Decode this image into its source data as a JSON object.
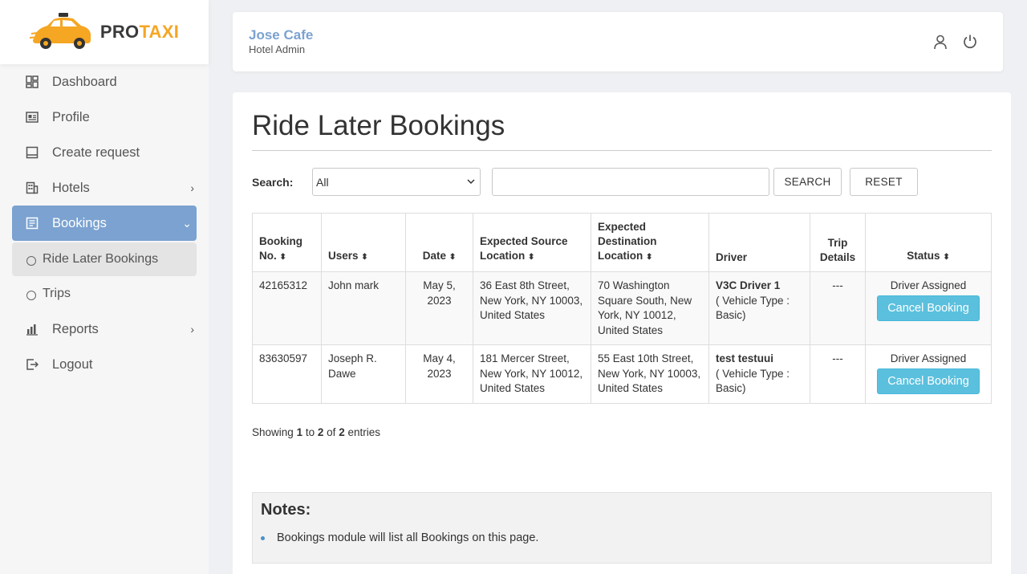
{
  "brand": {
    "pro": "PRO",
    "taxi": "TAXI",
    "accent": "#f5a623",
    "primary": "#7ba2d0"
  },
  "header": {
    "hotel_name": "Jose Cafe",
    "role": "Hotel Admin",
    "icons": [
      "user-icon",
      "power-icon"
    ]
  },
  "sidebar": {
    "items": [
      {
        "label": "Dashboard",
        "icon": "dashboard-icon"
      },
      {
        "label": "Profile",
        "icon": "profile-card-icon"
      },
      {
        "label": "Create request",
        "icon": "create-request-icon"
      },
      {
        "label": "Hotels",
        "icon": "building-icon"
      },
      {
        "label": "Bookings",
        "icon": "bookings-icon"
      },
      {
        "label": "Ride Later Bookings",
        "icon": "circle-icon"
      },
      {
        "label": "Trips",
        "icon": "circle-icon"
      },
      {
        "label": "Reports",
        "icon": "bar-chart-icon"
      },
      {
        "label": "Logout",
        "icon": "logout-icon"
      }
    ]
  },
  "main": {
    "title": "Ride Later Bookings",
    "search": {
      "label": "Search:",
      "selected": "All",
      "input_value": "",
      "search_button": "SEARCH",
      "reset_button": "RESET"
    },
    "table": {
      "headers": {
        "booking_no": "Booking No.",
        "users": "Users",
        "date": "Date",
        "source": "Expected Source Location",
        "destination": "Expected Destination Location",
        "driver": "Driver",
        "trip": "Trip Details",
        "status": "Status"
      },
      "rows": [
        {
          "booking_no": "42165312",
          "user": "John mark",
          "date": "May 5, 2023",
          "source": "36 East 8th Street, New York, NY 10003, United States",
          "destination": "70 Washington Square South, New York, NY 10012, United States",
          "driver_name": "V3C Driver 1",
          "vehicle": "( Vehicle Type : Basic)",
          "trip": "---",
          "status": "Driver Assigned",
          "action": "Cancel Booking"
        },
        {
          "booking_no": "83630597",
          "user": "Joseph R. Dawe",
          "date": "May 4, 2023",
          "source": "181 Mercer Street, New York, NY 10012, United States",
          "destination": "55 East 10th Street, New York, NY 10003, United States",
          "driver_name": "test testuui",
          "vehicle": "( Vehicle Type : Basic)",
          "trip": "---",
          "status": "Driver Assigned",
          "action": "Cancel Booking"
        }
      ]
    },
    "showing": {
      "prefix": "Showing",
      "from": "1",
      "to_word": "to",
      "to": "2",
      "of_word": "of",
      "total": "2",
      "suffix": "entries"
    },
    "notes": {
      "title": "Notes:",
      "items": [
        "Bookings module will list all Bookings on this page."
      ]
    }
  }
}
